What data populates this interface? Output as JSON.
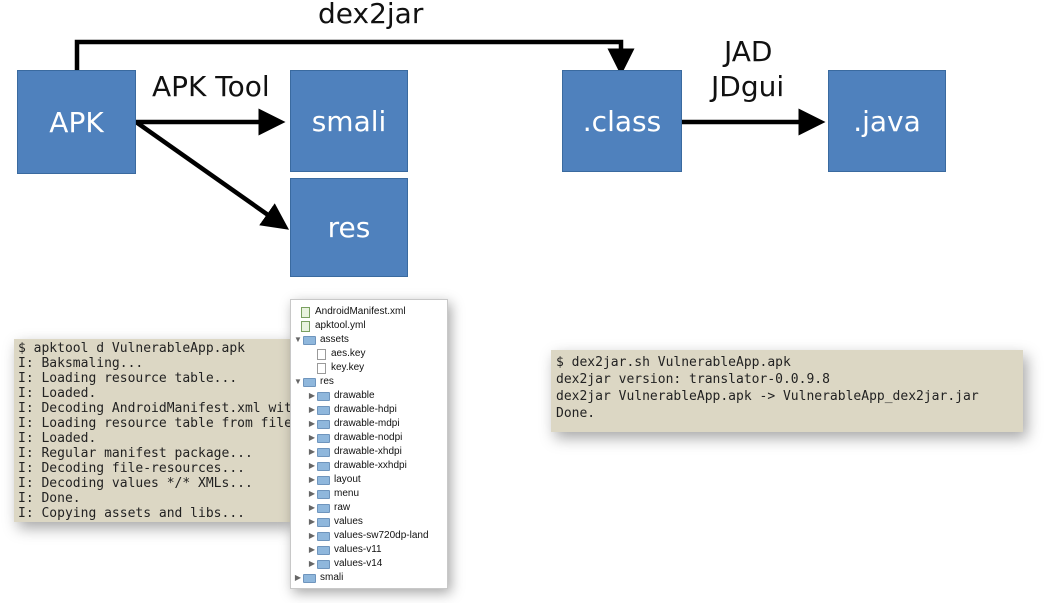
{
  "diagram": {
    "nodes": {
      "apk": "APK",
      "smali": "smali",
      "res": "res",
      "class": ".class",
      "java": ".java"
    },
    "edges": {
      "apktool": "APK Tool",
      "dex2jar": "dex2jar",
      "jad": "JAD",
      "jdgui": "JDgui"
    }
  },
  "terminal_apktool": {
    "lines": [
      "$ apktool d VulnerableApp.apk",
      "I: Baksmaling...",
      "I: Loading resource table...",
      "I: Loaded.",
      "I: Decoding AndroidManifest.xml with",
      "I: Loading resource table from file:",
      "I: Loaded.",
      "I: Regular manifest package...",
      "I: Decoding file-resources...",
      "I: Decoding values */* XMLs...",
      "I: Done.",
      "I: Copying assets and libs..."
    ]
  },
  "file_tree": {
    "items": [
      "AndroidManifest.xml",
      "apktool.yml",
      "assets",
      "aes.key",
      "key.key",
      "res",
      "drawable",
      "drawable-hdpi",
      "drawable-mdpi",
      "drawable-nodpi",
      "drawable-xhdpi",
      "drawable-xxhdpi",
      "layout",
      "menu",
      "raw",
      "values",
      "values-sw720dp-land",
      "values-v11",
      "values-v14",
      "smali"
    ]
  },
  "terminal_dex2jar": {
    "lines": [
      "$ dex2jar.sh VulnerableApp.apk",
      "dex2jar version: translator-0.0.9.8",
      "dex2jar VulnerableApp.apk -> VulnerableApp_dex2jar.jar",
      "Done."
    ]
  },
  "colors": {
    "box_fill": "#4f81bd",
    "terminal_bg": "#dcd7c4",
    "arrow": "#000000"
  }
}
